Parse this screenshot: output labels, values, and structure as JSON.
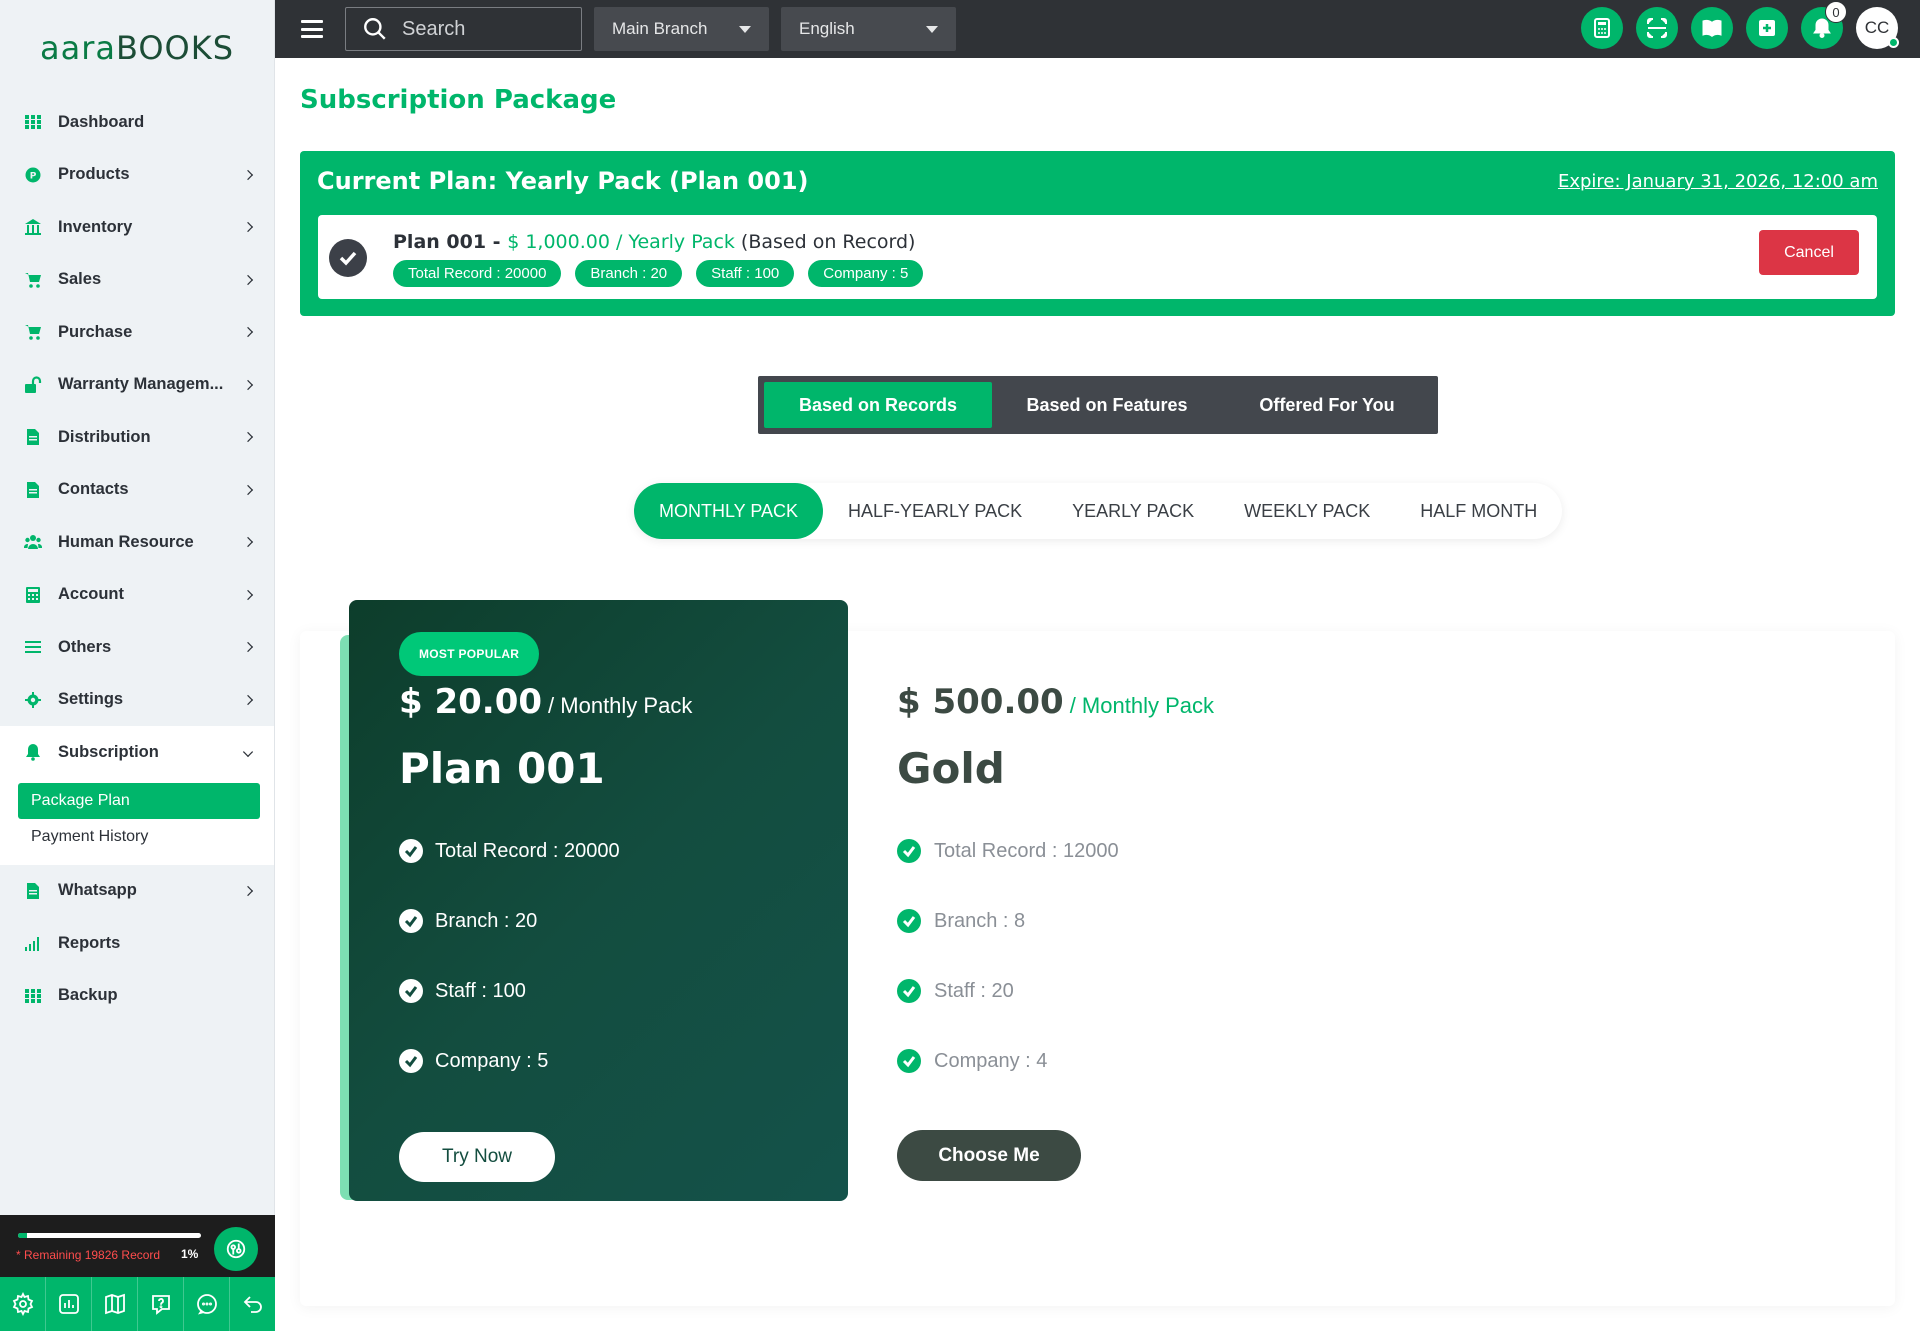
{
  "logo": {
    "part1": "aara",
    "part2": "BOOKS"
  },
  "sidebar": {
    "items": [
      {
        "label": "Dashboard",
        "icon": "grid-icon",
        "chevron": false
      },
      {
        "label": "Products",
        "icon": "product-icon",
        "chevron": true
      },
      {
        "label": "Inventory",
        "icon": "warehouse-icon",
        "chevron": true
      },
      {
        "label": "Sales",
        "icon": "cart-icon",
        "chevron": true
      },
      {
        "label": "Purchase",
        "icon": "cart-icon",
        "chevron": true
      },
      {
        "label": "Warranty Managem...",
        "icon": "unlock-icon",
        "chevron": true
      },
      {
        "label": "Distribution",
        "icon": "file-icon",
        "chevron": true
      },
      {
        "label": "Contacts",
        "icon": "file-icon",
        "chevron": true
      },
      {
        "label": "Human Resource",
        "icon": "users-icon",
        "chevron": true
      },
      {
        "label": "Account",
        "icon": "calculator-icon",
        "chevron": true
      },
      {
        "label": "Others",
        "icon": "list-icon",
        "chevron": true
      },
      {
        "label": "Settings",
        "icon": "gear-icon",
        "chevron": true
      },
      {
        "label": "Subscription",
        "icon": "bell-icon",
        "chevron": true
      },
      {
        "label": "Whatsapp",
        "icon": "file-icon",
        "chevron": true
      },
      {
        "label": "Reports",
        "icon": "bar-chart-icon",
        "chevron": false
      },
      {
        "label": "Backup",
        "icon": "grid-icon",
        "chevron": false
      }
    ],
    "subscription_sub": [
      {
        "label": "Package Plan",
        "active": true
      },
      {
        "label": "Payment History",
        "active": false
      }
    ],
    "remaining_text": "* Remaining 19826 Record",
    "remaining_pct": "1%",
    "remaining_fraction": 0.01
  },
  "topbar": {
    "search_placeholder": "Search",
    "branch": "Main Branch",
    "language": "English",
    "notif_count": "0",
    "avatar": "CC"
  },
  "page": {
    "title": "Subscription Package"
  },
  "current_plan": {
    "title": "Current Plan: Yearly Pack (Plan 001)",
    "expire": "Expire: January 31, 2026, 12:00 am",
    "name": "Plan 001 - ",
    "price": "$ 1,000.00 / Yearly Pack",
    "basis": " (Based on Record)",
    "tags": [
      "Total Record : 20000",
      "Branch : 20",
      "Staff : 100",
      "Company : 5"
    ],
    "cancel_label": "Cancel"
  },
  "category_tabs": [
    {
      "label": "Based on Records",
      "active": true
    },
    {
      "label": "Based on Features",
      "active": false
    },
    {
      "label": "Offered For You",
      "active": false
    }
  ],
  "period_tabs": [
    {
      "label": "MONTHLY PACK",
      "active": true
    },
    {
      "label": "HALF-YEARLY PACK",
      "active": false
    },
    {
      "label": "YEARLY PACK",
      "active": false
    },
    {
      "label": "WEEKLY PACK",
      "active": false
    },
    {
      "label": "HALF MONTH",
      "active": false
    }
  ],
  "plans": [
    {
      "badge": "MOST POPULAR",
      "price": "$ 20.00",
      "period": "/ Monthly Pack",
      "name": "Plan 001",
      "features": [
        "Total Record : 20000",
        "Branch : 20",
        "Staff : 100",
        "Company : 5"
      ],
      "button": "Try Now"
    },
    {
      "price": "$ 500.00",
      "period": "/ Monthly Pack",
      "name": "Gold",
      "features": [
        "Total Record : 12000",
        "Branch : 8",
        "Staff : 20",
        "Company : 4"
      ],
      "button": "Choose Me"
    }
  ],
  "colors": {
    "accent": "#00b66b",
    "dark": "#2f3236",
    "danger": "#dc3545",
    "card_dark": "#134d3f"
  }
}
